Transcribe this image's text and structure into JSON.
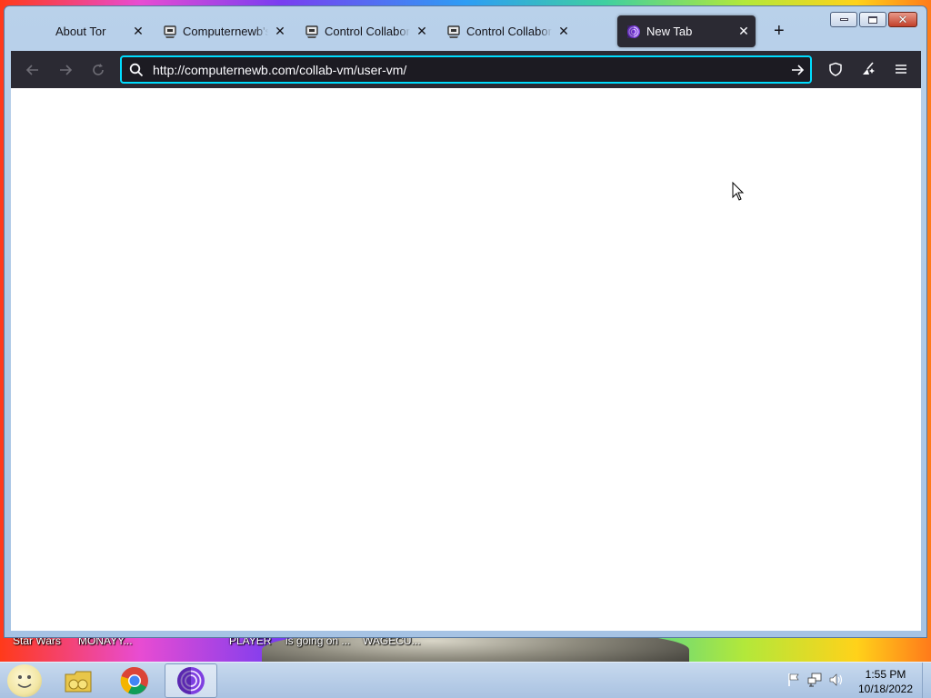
{
  "desktop": {
    "labels": [
      "Star Wars",
      "MONAYY...",
      "PLAYER",
      "is going on ...",
      "WAGECU..."
    ]
  },
  "browser": {
    "tabs": [
      {
        "title": "About Tor",
        "icon": "none",
        "active": false
      },
      {
        "title": "Computernewb's I",
        "icon": "computernewb-favicon",
        "active": false
      },
      {
        "title": "Control Collaborat",
        "icon": "computernewb-favicon",
        "active": false
      },
      {
        "title": "Control Collaborat",
        "icon": "computernewb-favicon",
        "active": false
      },
      {
        "title": "New Tab",
        "icon": "tor-onion-icon",
        "active": true
      }
    ],
    "new_tab_label": "+",
    "url": "http://computernewb.com/collab-vm/user-vm/",
    "accent_color": "#00ddff",
    "toolbar_color": "#2b2a33"
  },
  "taskbar": {
    "items": [
      "start-orb",
      "file-explorer",
      "google-chrome",
      "tor-browser"
    ],
    "active_item": "tor-browser",
    "tray_icons": [
      "flag-icon",
      "network-icon",
      "volume-icon"
    ],
    "clock": {
      "time": "1:55 PM",
      "date": "10/18/2022"
    }
  }
}
